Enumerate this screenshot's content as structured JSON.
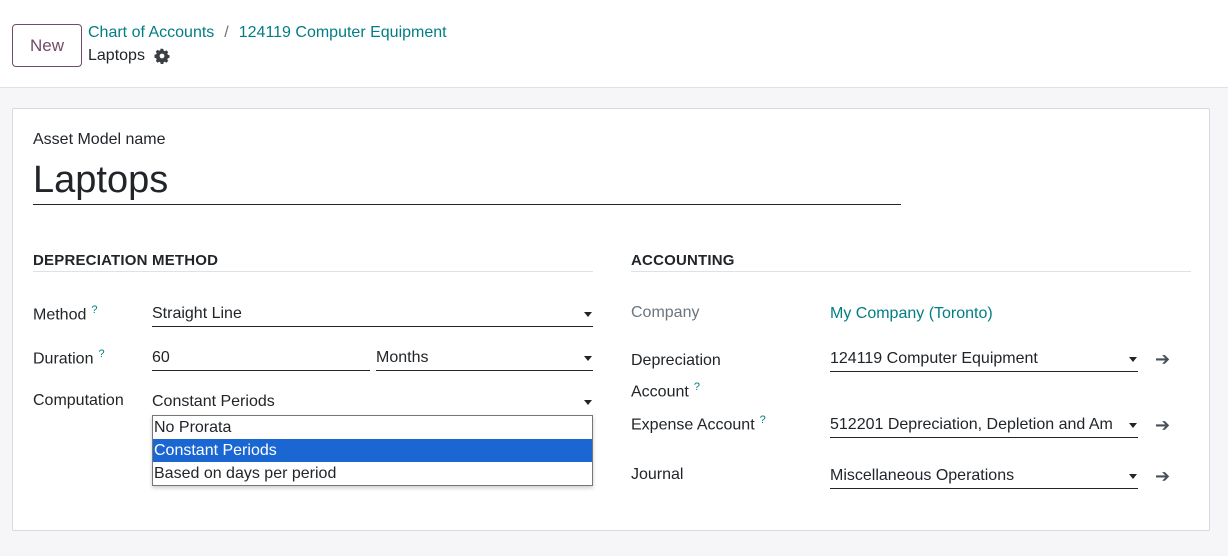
{
  "control_panel": {
    "new_label": "New",
    "breadcrumbs": [
      "Chart of Accounts",
      "124119 Computer Equipment"
    ],
    "separator": "/",
    "record_title": "Laptops",
    "settings_icon": "gear-icon"
  },
  "form": {
    "name_label": "Asset Model name",
    "name_value": "Laptops",
    "depreciation": {
      "title": "DEPRECIATION METHOD",
      "method_label": "Method",
      "method_value": "Straight Line",
      "duration_label": "Duration",
      "duration_value": "60",
      "duration_unit": "Months",
      "computation_label": "Computation",
      "computation_value": "Constant Periods",
      "computation_options": [
        "No Prorata",
        "Constant Periods",
        "Based on days per period"
      ],
      "computation_selected": "Constant Periods"
    },
    "accounting": {
      "title": "ACCOUNTING",
      "company_label": "Company",
      "company_value": "My Company (Toronto)",
      "depreciation_account_label_line1": "Depreciation",
      "depreciation_account_label_line2": "Account",
      "depreciation_account_value": "124119 Computer Equipment",
      "expense_account_label": "Expense Account",
      "expense_account_value": "512201 Depreciation, Depletion and Am",
      "journal_label": "Journal",
      "journal_value": "Miscellaneous Operations"
    },
    "help_marker": "?",
    "open_record_icon": "arrow-right-icon"
  }
}
